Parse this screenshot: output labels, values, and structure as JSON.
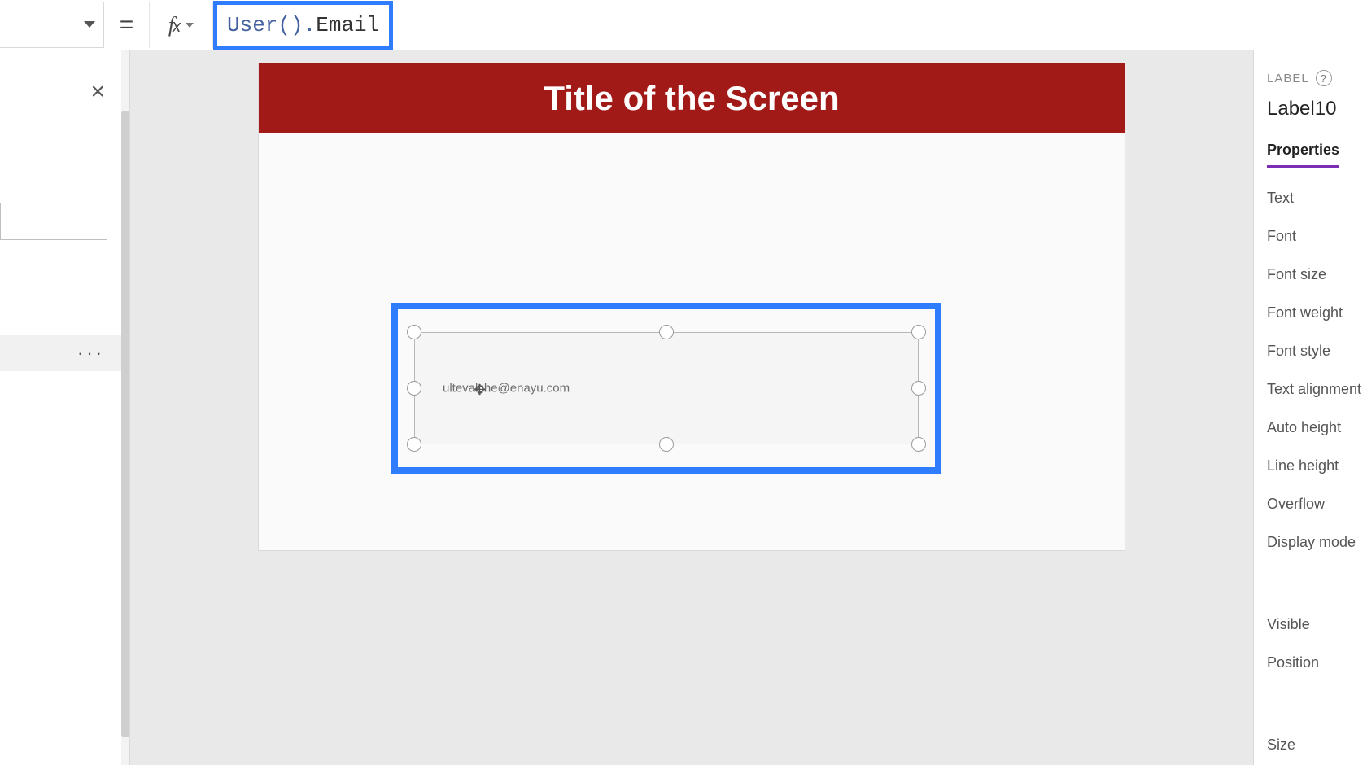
{
  "formula_bar": {
    "equals": "=",
    "fx_label": "fx",
    "formula_struct": "User().",
    "formula_member": "Email"
  },
  "left_panel": {
    "selected_row_more": "···"
  },
  "canvas": {
    "screen_title": "Title of the Screen",
    "label_value": "ultevalche@enayu.com"
  },
  "right_panel": {
    "kind": "LABEL",
    "help": "?",
    "control_name": "Label10",
    "active_tab": "Properties",
    "props": [
      "Text",
      "Font",
      "Font size",
      "Font weight",
      "Font style",
      "Text alignment",
      "Auto height",
      "Line height",
      "Overflow",
      "Display mode"
    ],
    "props2": [
      "Visible",
      "Position"
    ],
    "props3": [
      "Size"
    ]
  }
}
